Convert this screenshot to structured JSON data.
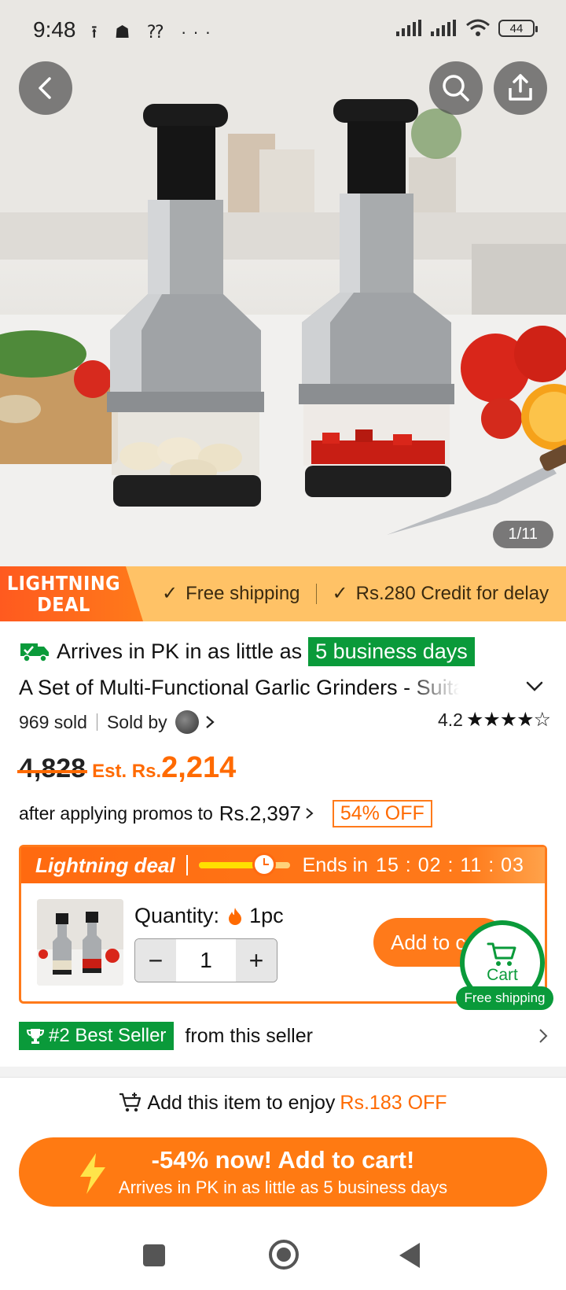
{
  "status_bar": {
    "time": "9:48",
    "left_icons": "⭱ ☗ ⁇ ···",
    "battery": "44"
  },
  "hero": {
    "image_counter": "1/11",
    "icons": [
      "back-icon",
      "search-icon",
      "share-icon"
    ]
  },
  "deal_banner": {
    "flag_line1": "LIGHTNING",
    "flag_line2": "DEAL",
    "item1": "Free shipping",
    "item2": "Rs.280 Credit for delay"
  },
  "product": {
    "arrives_text": "Arrives in PK in as little as",
    "arrives_days": "5 business days",
    "title": "A Set of Multi-Functional Garlic Grinders - Suitable for",
    "sold": "969 sold",
    "sold_by": "Sold by",
    "rating": "4.2",
    "stars": "★★★★☆",
    "old_price": "4,828",
    "est_label": "Est. Rs.",
    "new_price": "2,214",
    "promo_text": "after applying promos to",
    "promo_price": "Rs.2,397",
    "off_badge": "54% OFF"
  },
  "lightning_deal": {
    "title": "Lightning deal",
    "progress": 0.72,
    "ends_label": "Ends in",
    "timer": "15 : 02 : 11 : 03",
    "quantity_label": "Quantity:",
    "quantity_unit": "1pc",
    "quantity_value": "1",
    "minus": "−",
    "plus": "+",
    "add_button": "Add to cart"
  },
  "cart_float": {
    "label": "Cart",
    "shipping": "Free shipping"
  },
  "best_seller": {
    "badge": "#2 Best Seller",
    "text": "from this seller"
  },
  "enjoy": {
    "text": "Add this item to enjoy",
    "amount": "Rs.183 OFF"
  },
  "cta": {
    "main": "-54% now! Add to cart!",
    "sub": "Arrives in PK in as little as 5 business days"
  },
  "colors": {
    "accent": "#ff7a1a",
    "green": "#0a9a3a",
    "banner": "#ffc266"
  }
}
